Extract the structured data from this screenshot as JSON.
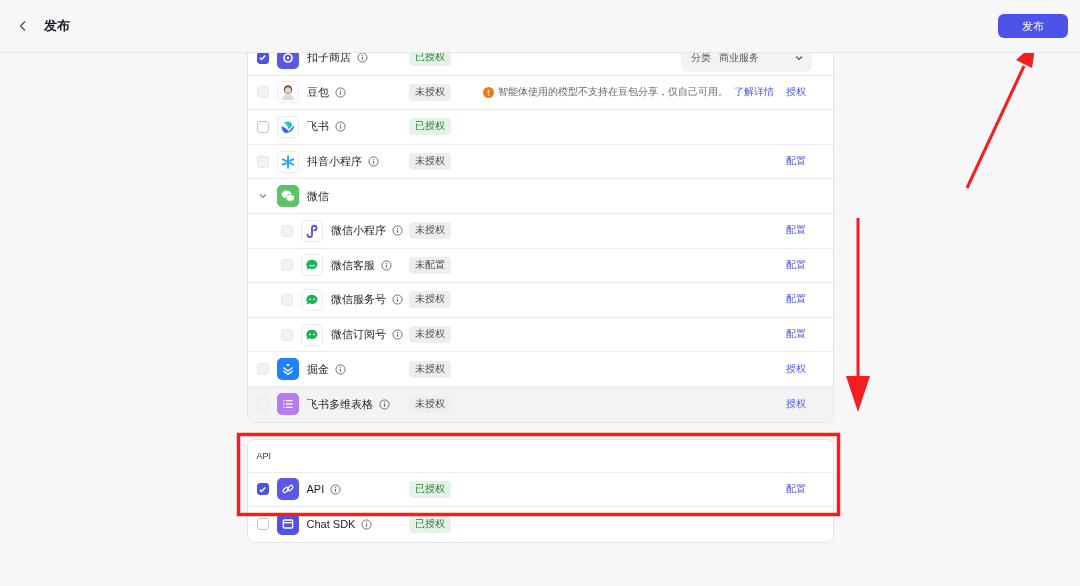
{
  "header": {
    "title": "发布",
    "publish_button": "发布"
  },
  "sections": [
    {
      "rows": [
        {
          "kind": "channel",
          "name": "扣子商店",
          "checked": true,
          "disabled": false,
          "status": "已授权",
          "authorized": true,
          "category_label": "分类",
          "category_value": "商业服务"
        },
        {
          "kind": "channel",
          "name": "豆包",
          "checked": false,
          "disabled": true,
          "status": "未授权",
          "authorized": false,
          "note": "智能体使用的模型不支持在豆包分享，仅自己可用。",
          "note_link": "了解详情",
          "action": "授权"
        },
        {
          "kind": "channel",
          "name": "飞书",
          "checked": false,
          "disabled": false,
          "status": "已授权",
          "authorized": true
        },
        {
          "kind": "channel",
          "name": "抖音小程序",
          "checked": false,
          "disabled": true,
          "status": "未授权",
          "authorized": false,
          "action": "配置"
        },
        {
          "kind": "group",
          "name": "微信",
          "expanded": true,
          "children": [
            {
              "kind": "channel",
              "name": "微信小程序",
              "checked": false,
              "disabled": true,
              "status": "未授权",
              "authorized": false,
              "action": "配置"
            },
            {
              "kind": "channel",
              "name": "微信客服",
              "checked": false,
              "disabled": true,
              "status": "未配置",
              "authorized": false,
              "action": "配置"
            },
            {
              "kind": "channel",
              "name": "微信服务号",
              "checked": false,
              "disabled": true,
              "status": "未授权",
              "authorized": false,
              "action": "配置"
            },
            {
              "kind": "channel",
              "name": "微信订阅号",
              "checked": false,
              "disabled": true,
              "status": "未授权",
              "authorized": false,
              "action": "配置"
            }
          ]
        },
        {
          "kind": "channel",
          "name": "掘金",
          "checked": false,
          "disabled": true,
          "status": "未授权",
          "authorized": false,
          "action": "授权"
        },
        {
          "kind": "channel",
          "name": "飞书多维表格",
          "checked": false,
          "disabled": true,
          "status": "未授权",
          "authorized": false,
          "action": "授权",
          "highlighted": true
        }
      ]
    },
    {
      "title": "API",
      "rows": [
        {
          "kind": "channel",
          "name": "API",
          "checked": true,
          "disabled": false,
          "status": "已授权",
          "authorized": true,
          "action": "配置"
        },
        {
          "kind": "channel",
          "name": "Chat SDK",
          "checked": false,
          "disabled": false,
          "status": "已授权",
          "authorized": true
        }
      ]
    }
  ]
}
